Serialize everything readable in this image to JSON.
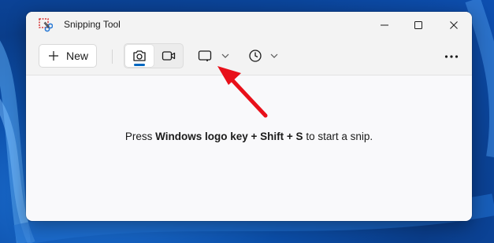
{
  "window": {
    "title": "Snipping Tool"
  },
  "toolbar": {
    "new_label": "New",
    "modes": [
      "snip",
      "record"
    ],
    "snip_shape_icon": "rectangle-snip-icon",
    "delay_icon": "clock-icon",
    "more_icon": "more-icon"
  },
  "main": {
    "hint_prefix": "Press ",
    "hint_keys": "Windows logo key + Shift + S",
    "hint_suffix": " to start a snip."
  },
  "colors": {
    "accent": "#0067c0",
    "annotation_arrow": "#e8101a"
  }
}
